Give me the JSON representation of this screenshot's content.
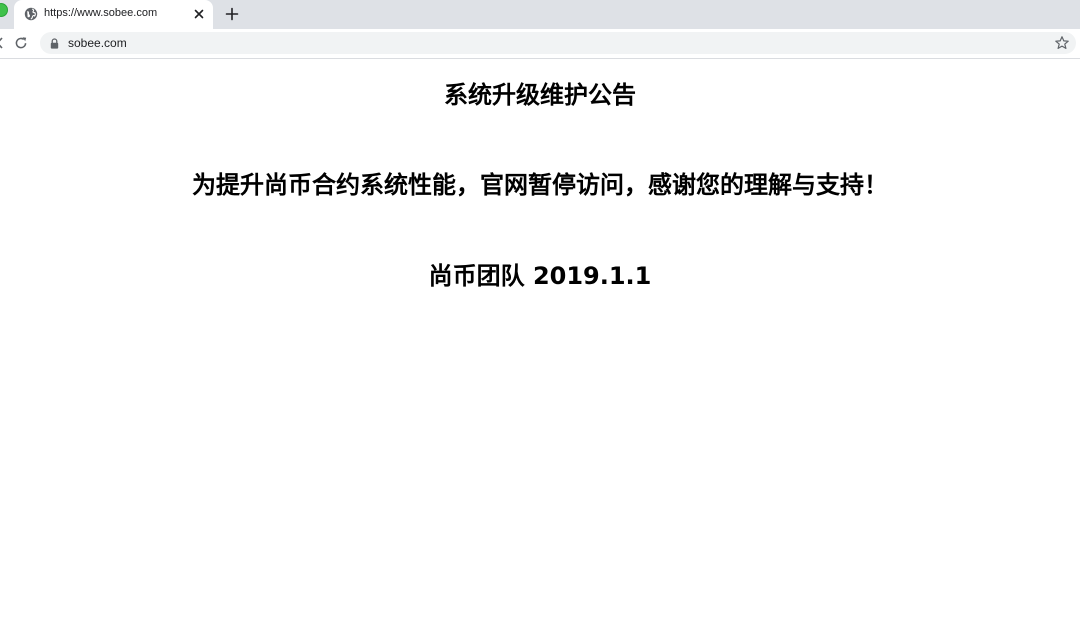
{
  "browser": {
    "tab": {
      "title": "https://www.sobee.com"
    },
    "address_bar": {
      "url": "sobee.com"
    },
    "colors": {
      "tabstrip_bg": "#dee1e6",
      "omnibox_bg": "#f1f3f4"
    }
  },
  "page": {
    "heading": "系统升级维护公告",
    "message": "为提升尚币合约系统性能，官网暂停访问，感谢您的理解与支持！",
    "signature": "尚币团队 2019.1.1"
  }
}
